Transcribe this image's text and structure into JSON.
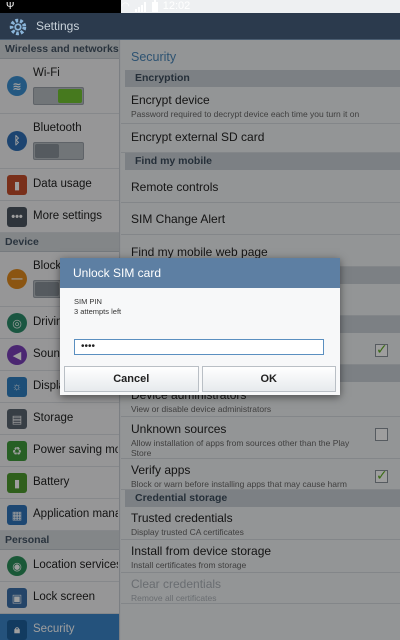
{
  "status": {
    "time": "12:02"
  },
  "appbar": {
    "title": "Settings"
  },
  "left": {
    "sections": [
      {
        "header": "Wireless and networks",
        "items": [
          {
            "label": "Wi-Fi",
            "icon": "wifi-icon",
            "toggle": "on"
          },
          {
            "label": "Bluetooth",
            "icon": "bluetooth-icon",
            "toggle": "off"
          },
          {
            "label": "Data usage",
            "icon": "data-usage-icon"
          },
          {
            "label": "More settings",
            "icon": "more-settings-icon"
          }
        ]
      },
      {
        "header": "Device",
        "items": [
          {
            "label": "Blocking mode",
            "icon": "blocking-mode-icon",
            "toggle": "off"
          },
          {
            "label": "Driving mode",
            "icon": "driving-mode-icon"
          },
          {
            "label": "Sound",
            "icon": "sound-icon"
          },
          {
            "label": "Display",
            "icon": "display-icon"
          },
          {
            "label": "Storage",
            "icon": "storage-icon"
          },
          {
            "label": "Power saving mode",
            "icon": "power-saving-icon"
          },
          {
            "label": "Battery",
            "icon": "battery-icon"
          },
          {
            "label": "Application manager",
            "icon": "application-manager-icon"
          }
        ]
      },
      {
        "header": "Personal",
        "items": [
          {
            "label": "Location services",
            "icon": "location-icon"
          },
          {
            "label": "Lock screen",
            "icon": "lock-screen-icon"
          },
          {
            "label": "Security",
            "icon": "security-icon",
            "active": true
          }
        ]
      }
    ]
  },
  "right": {
    "title": "Security",
    "sections": [
      {
        "header": "Encryption",
        "items": [
          {
            "title": "Encrypt device",
            "subtitle": "Password required to decrypt device each time you turn it on"
          },
          {
            "title": "Encrypt external SD card"
          }
        ]
      },
      {
        "header": "Find my mobile",
        "items": [
          {
            "title": "Remote controls"
          },
          {
            "title": "SIM Change Alert"
          },
          {
            "title": "Find my mobile web page"
          }
        ]
      },
      {
        "header": "",
        "items": [
          {
            "title": "",
            "checked": true
          }
        ]
      },
      {
        "header": "",
        "items": [
          {
            "title": "Device administrators",
            "subtitle": "View or disable device administrators"
          },
          {
            "title": "Unknown sources",
            "subtitle": "Allow installation of apps from sources other than the Play Store",
            "checked": false
          },
          {
            "title": "Verify apps",
            "subtitle": "Block or warn before installing apps that may cause harm",
            "checked": true
          }
        ]
      },
      {
        "header": "Credential storage",
        "items": [
          {
            "title": "Trusted credentials",
            "subtitle": "Display trusted CA certificates"
          },
          {
            "title": "Install from device storage",
            "subtitle": "Install certificates from storage"
          },
          {
            "title": "Clear credentials",
            "subtitle": "Remove all certificates",
            "disabled": true
          }
        ]
      }
    ]
  },
  "dialog": {
    "title": "Unlock SIM card",
    "label": "SIM PIN",
    "attempts": "3 attempts left",
    "pin_value": "••••",
    "cancel_label": "Cancel",
    "ok_label": "OK"
  }
}
